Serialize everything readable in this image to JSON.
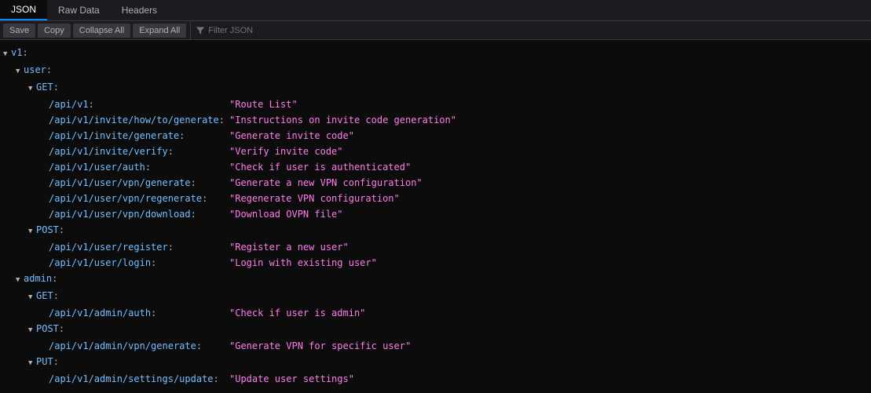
{
  "tabs": [
    {
      "label": "JSON",
      "active": true
    },
    {
      "label": "Raw Data",
      "active": false
    },
    {
      "label": "Headers",
      "active": false
    }
  ],
  "toolbar": {
    "save": "Save",
    "copy": "Copy",
    "collapse_all": "Collapse All",
    "expand_all": "Expand All",
    "filter_placeholder": "Filter JSON"
  },
  "json": {
    "root_key": "v1",
    "children": [
      {
        "key": "user",
        "children": [
          {
            "key": "GET",
            "entries": [
              {
                "k": "/api/v1",
                "v": "\"Route List\""
              },
              {
                "k": "/api/v1/invite/how/to/generate",
                "v": "\"Instructions on invite code generation\""
              },
              {
                "k": "/api/v1/invite/generate",
                "v": "\"Generate invite code\""
              },
              {
                "k": "/api/v1/invite/verify",
                "v": "\"Verify invite code\""
              },
              {
                "k": "/api/v1/user/auth",
                "v": "\"Check if user is authenticated\""
              },
              {
                "k": "/api/v1/user/vpn/generate",
                "v": "\"Generate a new VPN configuration\""
              },
              {
                "k": "/api/v1/user/vpn/regenerate",
                "v": "\"Regenerate VPN configuration\""
              },
              {
                "k": "/api/v1/user/vpn/download",
                "v": "\"Download OVPN file\""
              }
            ]
          },
          {
            "key": "POST",
            "entries": [
              {
                "k": "/api/v1/user/register",
                "v": "\"Register a new user\""
              },
              {
                "k": "/api/v1/user/login",
                "v": "\"Login with existing user\""
              }
            ]
          }
        ]
      },
      {
        "key": "admin",
        "children": [
          {
            "key": "GET",
            "entries": [
              {
                "k": "/api/v1/admin/auth",
                "v": "\"Check if user is admin\""
              }
            ]
          },
          {
            "key": "POST",
            "entries": [
              {
                "k": "/api/v1/admin/vpn/generate",
                "v": "\"Generate VPN for specific user\""
              }
            ]
          },
          {
            "key": "PUT",
            "entries": [
              {
                "k": "/api/v1/admin/settings/update",
                "v": "\"Update user settings\""
              }
            ]
          }
        ]
      }
    ]
  }
}
